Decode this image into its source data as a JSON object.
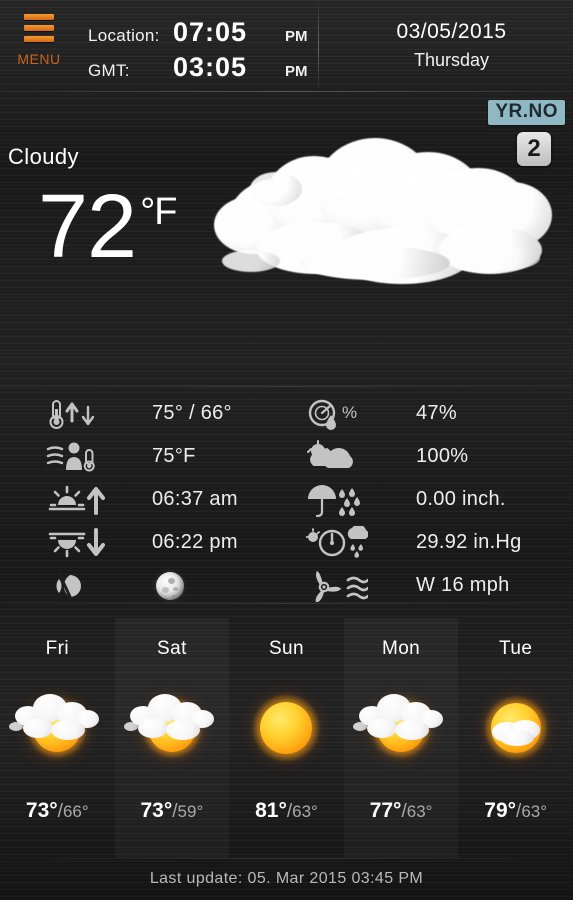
{
  "header": {
    "menu_label": "MENU",
    "menu_icon": "hamburger-menu-icon",
    "location_label": "Location:",
    "location_time": "07:05",
    "location_ampm": "PM",
    "gmt_label": "GMT:",
    "gmt_time": "03:05",
    "gmt_ampm": "PM",
    "date": "03/05/2015",
    "weekday": "Thursday"
  },
  "current": {
    "condition": "Cloudy",
    "temperature": "72",
    "unit": "°F",
    "icon": "cloudy-icon",
    "source_badge": "YR.NO",
    "source_count": "2"
  },
  "details": {
    "left": [
      {
        "icon": "thermometer-high-low-icon",
        "value": "75° / 66°"
      },
      {
        "icon": "feels-like-icon",
        "value": "75°F"
      },
      {
        "icon": "sunrise-icon",
        "value": "06:37 am"
      },
      {
        "icon": "sunset-icon",
        "value": "06:22 pm"
      },
      {
        "icon": "moon-phase-icon",
        "value": ""
      }
    ],
    "right": [
      {
        "icon": "humidity-icon",
        "value": "47%"
      },
      {
        "icon": "cloudiness-icon",
        "value": "100%"
      },
      {
        "icon": "precipitation-icon",
        "value": "0.00 inch."
      },
      {
        "icon": "pressure-icon",
        "value": "29.92 in.Hg"
      },
      {
        "icon": "wind-icon",
        "value": "W 16 mph"
      }
    ]
  },
  "forecast": [
    {
      "day": "Fri",
      "icon": "partly-cloudy-icon",
      "high": "73°",
      "sep": "/",
      "low": "66°"
    },
    {
      "day": "Sat",
      "icon": "partly-cloudy-icon",
      "high": "73°",
      "sep": "/",
      "low": "59°"
    },
    {
      "day": "Sun",
      "icon": "sunny-icon",
      "high": "81°",
      "sep": "/",
      "low": "63°"
    },
    {
      "day": "Mon",
      "icon": "partly-cloudy-icon",
      "high": "77°",
      "sep": "/",
      "low": "63°"
    },
    {
      "day": "Tue",
      "icon": "mostly-sunny-icon",
      "high": "79°",
      "sep": "/",
      "low": "63°"
    }
  ],
  "footer": {
    "last_update": "Last update: 05. Mar 2015  03:45 PM"
  },
  "colors": {
    "accent": "#d4691a",
    "badge_bg": "#8fb7c4",
    "text": "#ffffff",
    "muted": "#a9a9a9"
  }
}
